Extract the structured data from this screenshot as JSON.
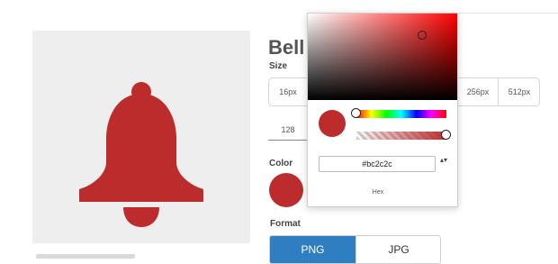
{
  "icon": {
    "name": "bell-icon",
    "color": "#bc2c2c"
  },
  "panel": {
    "title": "Bell",
    "size_label": "Size",
    "sizes": [
      "16px",
      "256px",
      "512px"
    ],
    "size_custom_tab": "128",
    "color_label": "Color",
    "format_label": "Format",
    "formats": [
      "PNG",
      "JPG"
    ],
    "selected_format": "PNG"
  },
  "picker": {
    "hex_value": "#bc2c2c",
    "mode_label": "Hex",
    "toggle_glyph": "▴▾",
    "color": "#bc2c2c",
    "accent": "#2f7ec1"
  }
}
